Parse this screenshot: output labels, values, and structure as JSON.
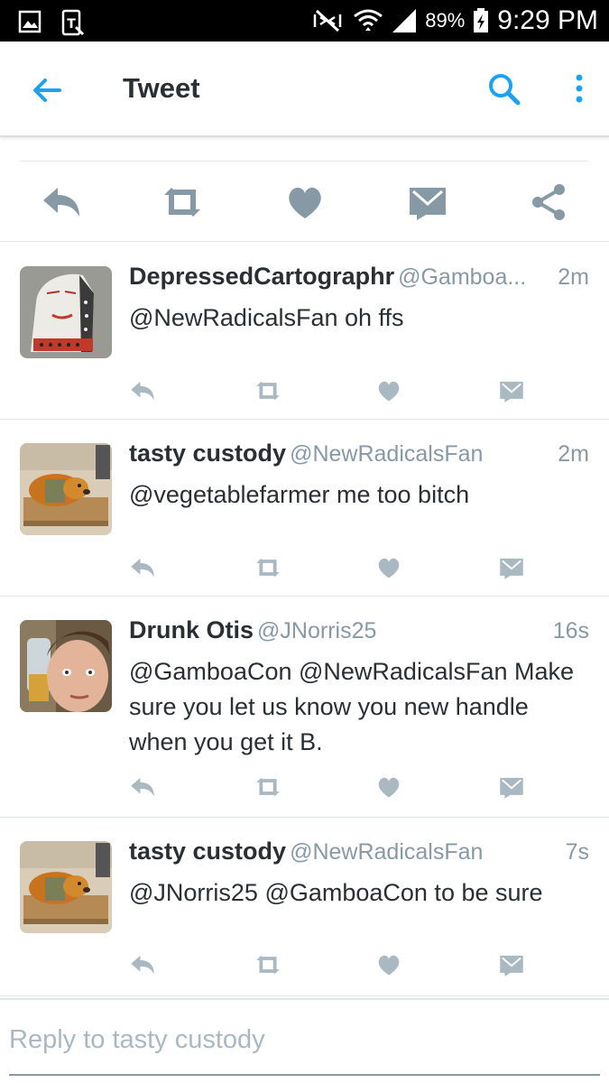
{
  "status_bar": {
    "battery": "89%",
    "time": "9:29 PM",
    "icons": [
      "gallery-icon",
      "tmobile-icon",
      "mute-icon",
      "wifi-icon",
      "signal-icon",
      "battery-icon"
    ]
  },
  "app_bar": {
    "title": "Tweet",
    "icons": [
      "back-arrow-icon",
      "search-icon",
      "more-vert-icon"
    ],
    "accent_color": "#1da1f2"
  },
  "action_bar": {
    "icons": [
      "reply-icon",
      "retweet-icon",
      "like-icon",
      "direct-message-icon",
      "share-icon"
    ],
    "icon_color": "#8899a6"
  },
  "tweets": [
    {
      "name": "DepressedCartographr",
      "handle": "@Gamboa...",
      "time": "2m",
      "text": "@NewRadicalsFan oh ffs",
      "avatar": "drawing-face-avatar"
    },
    {
      "name": "tasty custody",
      "handle": "@NewRadicalsFan",
      "time": "2m",
      "text": "@vegetablefarmer me too bitch",
      "avatar": "dog-avatar"
    },
    {
      "name": "Drunk Otis",
      "handle": "@JNorris25",
      "time": "16s",
      "text": "@GamboaCon @NewRadicalsFan Make sure you let us know you new handle when you get it B.",
      "avatar": "person-avatar"
    },
    {
      "name": "tasty custody",
      "handle": "@NewRadicalsFan",
      "time": "7s",
      "text": "@JNorris25 @GamboaCon to be sure",
      "avatar": "dog-avatar"
    }
  ],
  "reply": {
    "placeholder": "Reply to tasty custody"
  }
}
